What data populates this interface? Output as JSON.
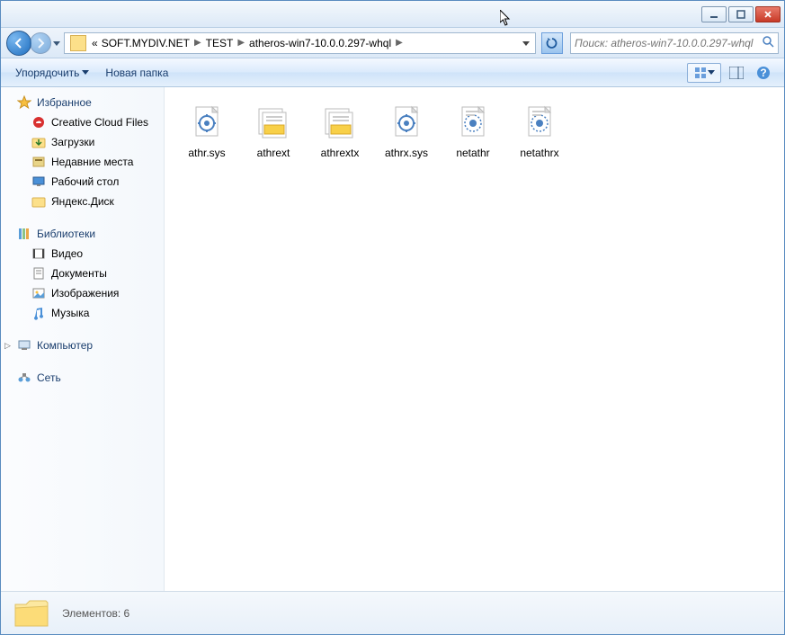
{
  "window": {
    "minimize": "—",
    "maximize": "☐",
    "close": "✕"
  },
  "address": {
    "prefix": "«",
    "crumbs": [
      "SOFT.MYDIV.NET",
      "TEST",
      "atheros-win7-10.0.0.297-whql"
    ]
  },
  "search": {
    "placeholder": "Поиск: atheros-win7-10.0.0.297-whql"
  },
  "toolbar": {
    "organize": "Упорядочить",
    "newfolder": "Новая папка"
  },
  "sidebar": {
    "favorites": {
      "label": "Избранное",
      "items": [
        "Creative Cloud Files",
        "Загрузки",
        "Недавние места",
        "Рабочий стол",
        "Яндекс.Диск"
      ]
    },
    "libraries": {
      "label": "Библиотеки",
      "items": [
        "Видео",
        "Документы",
        "Изображения",
        "Музыка"
      ]
    },
    "computer": {
      "label": "Компьютер"
    },
    "network": {
      "label": "Сеть"
    }
  },
  "files": [
    {
      "name": "athr.sys",
      "type": "sys"
    },
    {
      "name": "athrext",
      "type": "cat"
    },
    {
      "name": "athrextx",
      "type": "cat"
    },
    {
      "name": "athrx.sys",
      "type": "sys"
    },
    {
      "name": "netathr",
      "type": "inf"
    },
    {
      "name": "netathrx",
      "type": "inf"
    }
  ],
  "status": {
    "text": "Элементов: 6"
  }
}
